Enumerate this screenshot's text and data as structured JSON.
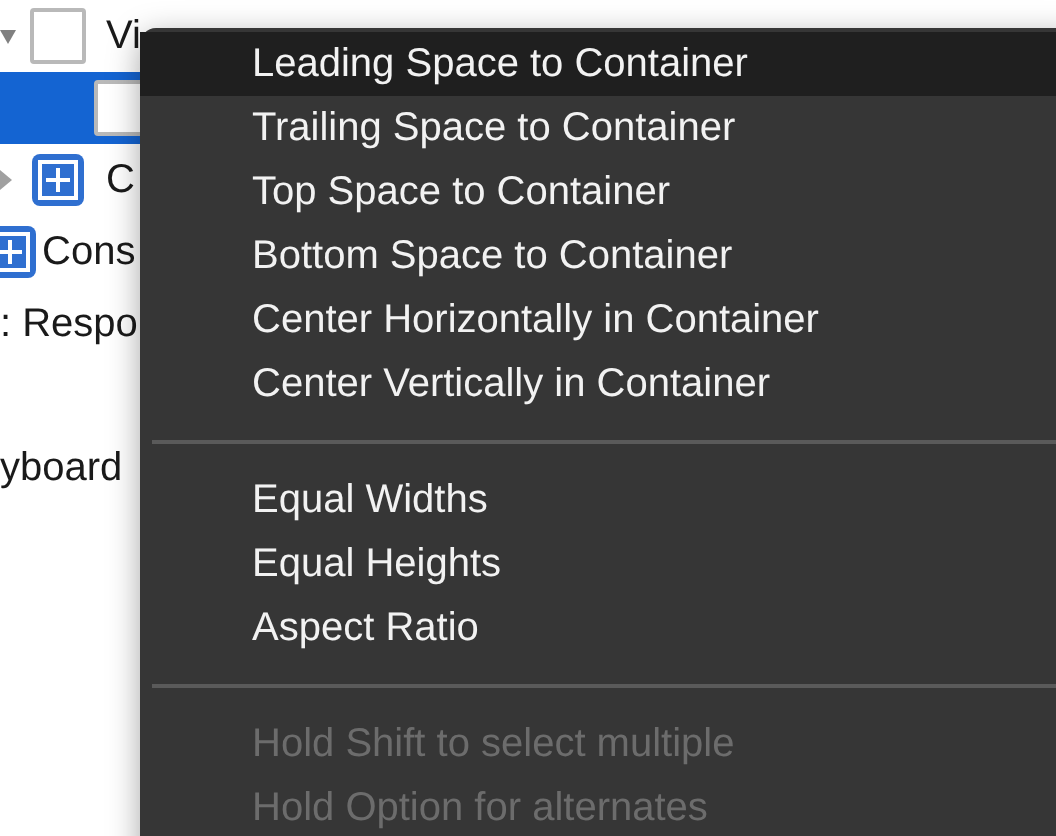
{
  "outline": [
    {
      "label": "Vi",
      "kind": "view",
      "expanded": true,
      "selected": false,
      "children": [
        {
          "kind": "view",
          "selected": true
        }
      ]
    },
    {
      "label": "C",
      "kind": "constraints",
      "expanded": false,
      "selected": false
    }
  ],
  "outline_tail": [
    {
      "label": "Cons",
      "kind": "constraints"
    },
    {
      "label": ": Respo",
      "kind": "object"
    },
    {
      "kind": "blank"
    },
    {
      "label": "yboard",
      "kind": "object"
    }
  ],
  "menu": {
    "sections": [
      [
        {
          "label": "Leading Space to Container",
          "selected": true,
          "disabled": false
        },
        {
          "label": "Trailing Space to Container",
          "selected": false,
          "disabled": false
        },
        {
          "label": "Top Space to Container",
          "selected": false,
          "disabled": false
        },
        {
          "label": "Bottom Space to Container",
          "selected": false,
          "disabled": false
        },
        {
          "label": "Center Horizontally in Container",
          "selected": false,
          "disabled": false
        },
        {
          "label": "Center Vertically in Container",
          "selected": false,
          "disabled": false
        }
      ],
      [
        {
          "label": "Equal Widths",
          "selected": false,
          "disabled": false
        },
        {
          "label": "Equal Heights",
          "selected": false,
          "disabled": false
        },
        {
          "label": "Aspect Ratio",
          "selected": false,
          "disabled": false
        }
      ],
      [
        {
          "label": "Hold Shift to select multiple",
          "selected": false,
          "disabled": true
        },
        {
          "label": "Hold Option for alternates",
          "selected": false,
          "disabled": true
        }
      ]
    ]
  }
}
